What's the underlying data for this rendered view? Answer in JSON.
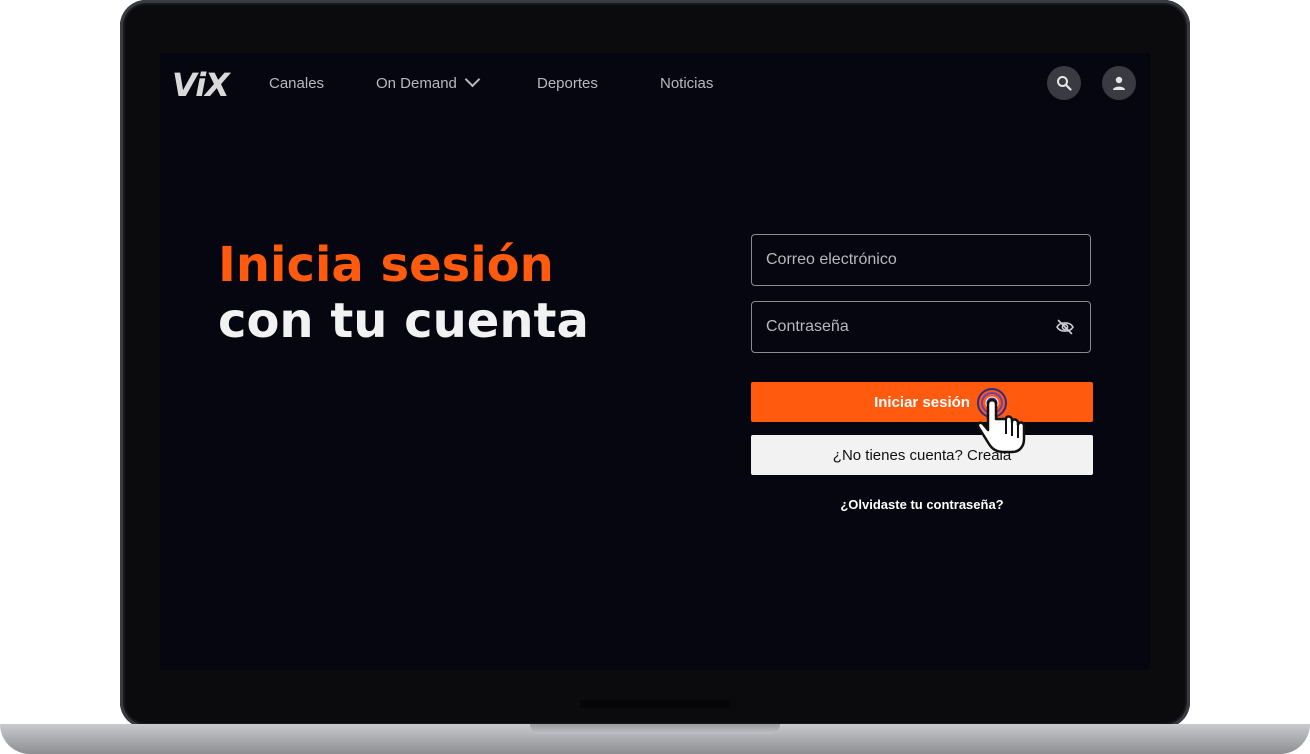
{
  "nav": {
    "logo": "ViX",
    "items": [
      {
        "label": "Canales"
      },
      {
        "label": "On Demand",
        "has_dropdown": true
      },
      {
        "label": "Deportes"
      },
      {
        "label": "Noticias"
      }
    ],
    "search_icon": "search-icon",
    "account_icon": "user-icon"
  },
  "hero": {
    "line1": "Inicia sesión",
    "line2": "con tu cuenta"
  },
  "form": {
    "email_placeholder": "Correo electrónico",
    "email_value": "",
    "password_placeholder": "Contraseña",
    "password_value": "",
    "password_toggle_icon": "eye-off-icon",
    "login_button": "Iniciar sesión",
    "signup_button": "¿No tienes cuenta? Creala",
    "forgot_link": "¿Olvidaste tu contraseña?"
  },
  "colors": {
    "accent": "#ff5a0e",
    "background": "#050610",
    "text": "#f2f2f2"
  }
}
